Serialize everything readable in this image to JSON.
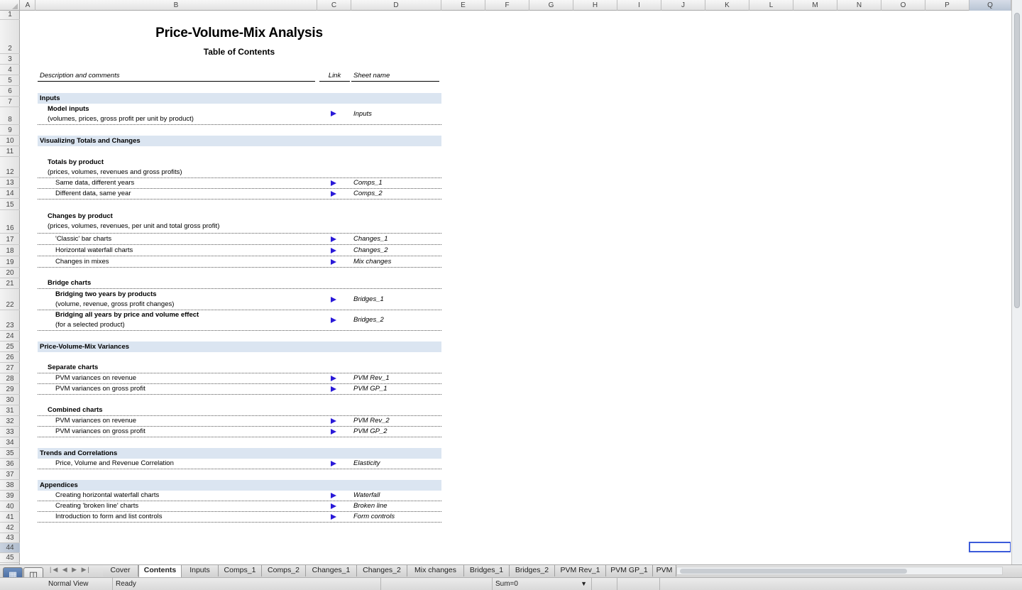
{
  "columns": [
    "A",
    "B",
    "C",
    "D",
    "E",
    "F",
    "G",
    "H",
    "I",
    "J",
    "K",
    "L",
    "M",
    "N",
    "O",
    "P",
    "Q"
  ],
  "rows": [
    "1",
    "2",
    "3",
    "4",
    "5",
    "6",
    "7",
    "8",
    "9",
    "10",
    "11",
    "12",
    "13",
    "14",
    "15",
    "16",
    "17",
    "18",
    "19",
    "20",
    "21",
    "22",
    "23",
    "24",
    "25",
    "26",
    "27",
    "28",
    "29",
    "30",
    "31",
    "32",
    "33",
    "34",
    "35",
    "36",
    "37",
    "38",
    "39",
    "40",
    "41",
    "42",
    "43",
    "44",
    "45"
  ],
  "title": "Price-Volume-Mix Analysis",
  "subtitle": "Table of Contents",
  "headers": {
    "description": "Description and comments",
    "link": "Link",
    "sheet": "Sheet name"
  },
  "sections": {
    "inputs": "Inputs",
    "visualizing": "Visualizing Totals and Changes",
    "pvm": "Price-Volume-Mix Variances",
    "trends": "Trends and Correlations",
    "appendices": "Appendices"
  },
  "text": {
    "model_inputs": "Model inputs",
    "model_inputs_desc": "(volumes, prices, gross profit per unit by product)",
    "totals": "Totals by product",
    "totals_desc": "(prices, volumes, revenues and gross profits)",
    "same_data": "Same data, different years",
    "diff_data": "Different data, same year",
    "changes": "Changes by product",
    "changes_desc": "(prices, volumes, revenues, per unit and total gross profit)",
    "classic": "'Classic' bar charts",
    "horiz_wf": "Horizontal waterfall charts",
    "mixes": "Changes in mixes",
    "bridge": "Bridge charts",
    "bridge_two": "Bridging two years by products",
    "bridge_two_desc": "(volume, revenue, gross profit changes)",
    "bridge_all": "Bridging all years by price and volume effect",
    "bridge_all_desc": "(for a selected product)",
    "separate": "Separate charts",
    "pvm_rev": "PVM variances on revenue",
    "pvm_gp": "PVM variances on gross profit",
    "combined": "Combined charts",
    "pvm_rev2": "PVM variances on revenue",
    "pvm_gp2": "PVM variances on gross profit",
    "pvr_corr": "Price, Volume and Revenue Correlation",
    "creating_wf": "Creating horizontal waterfall charts",
    "creating_bl": "Creating 'broken line' charts",
    "intro_forms": "Introduction to form and list controls"
  },
  "sheets": {
    "inputs": "Inputs",
    "comps1": "Comps_1",
    "comps2": "Comps_2",
    "changes1": "Changes_1",
    "changes2": "Changes_2",
    "mix": "Mix changes",
    "bridges1": "Bridges_1",
    "bridges2": "Bridges_2",
    "pvmrev1": "PVM Rev_1",
    "pvmgp1": "PVM GP_1",
    "pvmrev2": "PVM Rev_2",
    "pvmgp2": "PVM GP_2",
    "elasticity": "Elasticity",
    "waterfall": "Waterfall",
    "broken": "Broken line",
    "forms": "Form controls"
  },
  "tabs": [
    "Cover",
    "Contents",
    "Inputs",
    "Comps_1",
    "Comps_2",
    "Changes_1",
    "Changes_2",
    "Mix changes",
    "Bridges_1",
    "Bridges_2",
    "PVM Rev_1",
    "PVM GP_1",
    "PVM"
  ],
  "active_tab": "Contents",
  "tab_nav": "|◀ ◀ ▶ ▶|",
  "status": {
    "view": "Normal View",
    "state": "Ready",
    "sum": "Sum=0"
  },
  "accent_color": "#2a1ad8",
  "band_color": "#dbe5f1"
}
